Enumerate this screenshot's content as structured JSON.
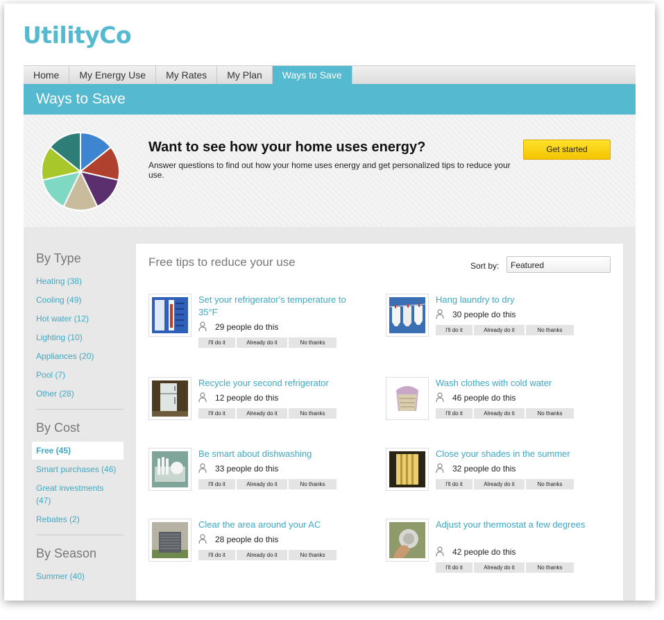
{
  "brand": {
    "logo_text": "UtilityCo",
    "accent_color": "#55b9d0",
    "link_color": "#3da8c3",
    "button_color": "#f5c400"
  },
  "nav": {
    "tabs": [
      {
        "label": "Home"
      },
      {
        "label": "My Energy Use"
      },
      {
        "label": "My Rates"
      },
      {
        "label": "My Plan"
      },
      {
        "label": "Ways to Save",
        "active": true
      }
    ]
  },
  "banner": {
    "title": "Ways to Save"
  },
  "hero": {
    "icon": "pie-chart-graphic",
    "headline": "Want to see how your home uses energy?",
    "description": "Answer questions to find out how your home uses energy and get personalized tips to reduce your use.",
    "cta_label": "Get started",
    "pie_colors": [
      "#3d85d0",
      "#b0412f",
      "#5b2e6e",
      "#c9bc9d",
      "#7fd8c1",
      "#a7c72a",
      "#2e7e77"
    ]
  },
  "sidebar": {
    "by_type": {
      "heading": "By Type",
      "items": [
        "Heating (38)",
        "Cooling (49)",
        "Hot water (12)",
        "Lighting (10)",
        "Appliances (20)",
        "Pool (7)",
        "Other (28)"
      ]
    },
    "by_cost": {
      "heading": "By Cost",
      "items": [
        "Free (45)",
        "Smart purchases (46)",
        "Great investments (47)",
        "Rebates (2)"
      ],
      "active_index": 0
    },
    "by_season": {
      "heading": "By Season",
      "items": [
        "Summer (40)"
      ]
    }
  },
  "main": {
    "title": "Free tips to reduce your use",
    "sort_label": "Sort by:",
    "sort_value": "Featured",
    "button_labels": {
      "do": "I'll do it",
      "already": "Already do it",
      "no": "No thanks"
    },
    "tips": [
      {
        "title": "Set your refrigerator's temperature to 35°F",
        "count": "29 people do this",
        "thumb": "thermometer-photo"
      },
      {
        "title": "Hang laundry to dry",
        "count": "30 people do this",
        "thumb": "laundry-line-photo"
      },
      {
        "title": "Recycle your second refrigerator",
        "count": "12 people do this",
        "thumb": "old-refrigerator-photo"
      },
      {
        "title": "Wash clothes with cold water",
        "count": "46 people do this",
        "thumb": "laundry-basket-photo"
      },
      {
        "title": "Be smart about dishwashing",
        "count": "33 people do this",
        "thumb": "dish-rack-photo"
      },
      {
        "title": "Close your shades in the summer",
        "count": "32 people do this",
        "thumb": "window-shades-photo"
      },
      {
        "title": "Clear the area around your AC",
        "count": "28 people do this",
        "thumb": "ac-unit-photo"
      },
      {
        "title": "Adjust your thermostat a few degrees",
        "count": "42 people do this",
        "thumb": "thermostat-photo"
      }
    ]
  }
}
